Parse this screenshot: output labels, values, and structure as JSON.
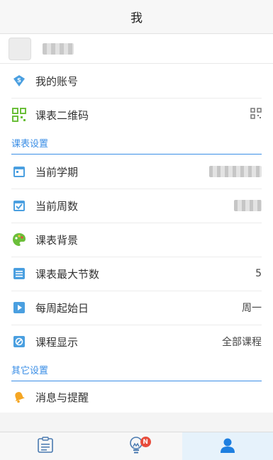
{
  "header": {
    "title": "我"
  },
  "profile": {
    "name": "▮▮▮▮▮"
  },
  "menu": [
    {
      "label": "我的账号",
      "icon": "account-icon"
    },
    {
      "label": "课表二维码",
      "icon": "qrcode-icon",
      "trailing_icon": "qrcode-icon"
    }
  ],
  "schedule_settings": {
    "title": "课表设置",
    "items": [
      {
        "label": "当前学期",
        "value": "▮▮▮▮ ▮▮▮▮▮",
        "icon": "calendar-icon"
      },
      {
        "label": "当前周数",
        "value": "▮▮▮▮▮",
        "icon": "check-calendar-icon"
      },
      {
        "label": "课表背景",
        "value": "",
        "icon": "palette-icon"
      },
      {
        "label": "课表最大节数",
        "value": "5",
        "icon": "list-icon"
      },
      {
        "label": "每周起始日",
        "value": "周一",
        "icon": "play-icon"
      },
      {
        "label": "课程显示",
        "value": "全部课程",
        "icon": "display-icon"
      }
    ]
  },
  "other_settings": {
    "title": "其它设置",
    "items": [
      {
        "label": "消息与提醒",
        "icon": "bell-icon"
      }
    ]
  },
  "tabbar": {
    "tabs": [
      {
        "icon": "schedule-icon",
        "active": false
      },
      {
        "icon": "lightbulb-icon",
        "active": false,
        "badge": "N"
      },
      {
        "icon": "user-icon",
        "active": true
      }
    ]
  },
  "colors": {
    "accent": "#3a8ee6",
    "badge": "#e74c3c",
    "active_tab_bg": "#e6f2fb"
  }
}
